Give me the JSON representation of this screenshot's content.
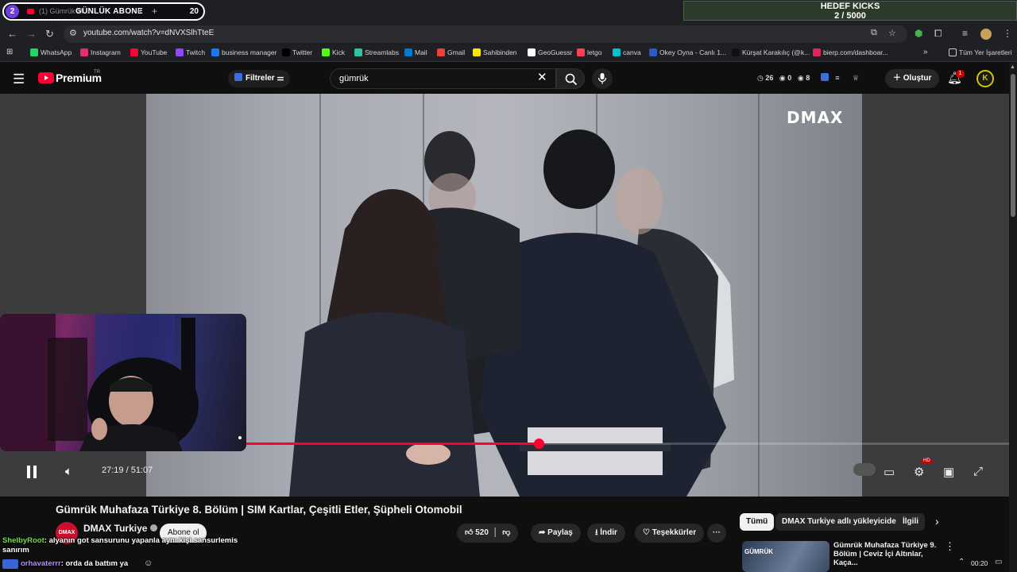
{
  "tabbar": {
    "sub_count": "2",
    "tab_title": "(1) Gümrük M...",
    "sub_label": "GÜNLÜK ABONE",
    "tab_close": "✕",
    "new_tab": "+",
    "sub_value": "20",
    "goal_title": "HEDEF KICKS",
    "goal_value": "2 / 5000"
  },
  "address": {
    "url": "youtube.com/watch?v=dNVXSlhTteE"
  },
  "bookmarks": [
    {
      "label": "WhatsApp",
      "color": "#25d366"
    },
    {
      "label": "Instagram",
      "color": "#e1306c"
    },
    {
      "label": "YouTube",
      "color": "#ff0033"
    },
    {
      "label": "Twitch",
      "color": "#9146ff"
    },
    {
      "label": "business manager",
      "color": "#1877f2"
    },
    {
      "label": "Twitter",
      "color": "#000000"
    },
    {
      "label": "Kick",
      "color": "#53fc18"
    },
    {
      "label": "Streamlabs",
      "color": "#31c3a2"
    },
    {
      "label": "Mail",
      "color": "#0078d4"
    },
    {
      "label": "Gmail",
      "color": "#ea4335"
    },
    {
      "label": "Sahibinden",
      "color": "#ffe800"
    },
    {
      "label": "GeoGuessr",
      "color": "#ffffff"
    },
    {
      "label": "letgo",
      "color": "#ff3f55"
    },
    {
      "label": "canva",
      "color": "#00c4cc"
    },
    {
      "label": "Okey Oyna - Canlı 1...",
      "color": "#2b59c3"
    },
    {
      "label": "Kürşat Karakılıç (@k...",
      "color": "#111111"
    },
    {
      "label": "bierp.com/dashboar...",
      "color": "#e0245e"
    }
  ],
  "bookmarks_more": "»",
  "bookmarks_all": "Tüm Yer İşaretleri",
  "header": {
    "brand": "Premium",
    "region": "TR",
    "filters_label": "Filtreler",
    "search_value": "gümrük",
    "stats": [
      "26",
      "0",
      "8"
    ],
    "create_label": "Oluştur",
    "notif_count": "1",
    "avatar_letter": "K"
  },
  "player": {
    "channel_watermark": "DMAX",
    "time": "27:19 / 51:07",
    "progress": 0.534,
    "hd_label": "HD"
  },
  "video": {
    "title": "Gümrük Muhafaza Türkiye 8. Bölüm | SIM Kartlar, Çeşitli Etler, Şüpheli Otomobil",
    "channel_logo": "DMAX",
    "channel": "DMAX Turkiye",
    "subscribe_label": "Abone ol",
    "likes": "520",
    "share_label": "Paylaş",
    "download_label": "İndir",
    "thanks_label": "Teşekkürler",
    "more_label": "···"
  },
  "chips": [
    "Tümü",
    "DMAX Turkiye adlı yükleyiciden",
    "İlgili"
  ],
  "recommendation": {
    "thumb_text": "GÜMRÜK",
    "title": "Gümrük Muhafaza Türkiye 9. Bölüm | Ceviz İçi Altınlar, Kaça..."
  },
  "chat": [
    {
      "user": "ShelbyRoot",
      "message": ": alyanın got sansurunu yapanla aynı kişi sansurlemis sanırım"
    },
    {
      "user": "orhavaterrr",
      "message": ": orda da battım ya"
    }
  ],
  "tray": {
    "time": "00:20"
  }
}
